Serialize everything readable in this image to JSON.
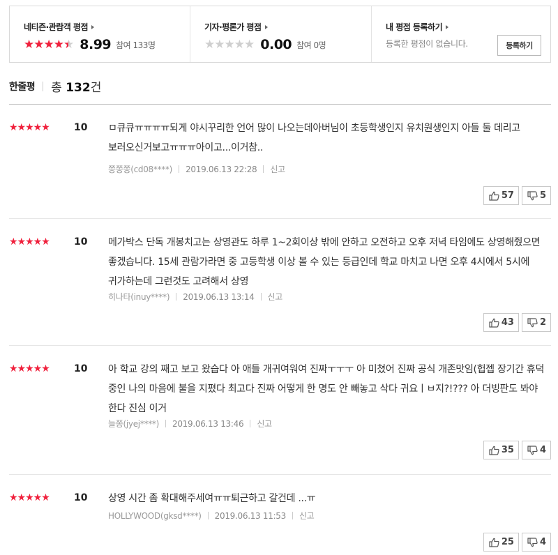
{
  "scores": {
    "audience": {
      "title": "네티즌·관람객 평점",
      "stars": [
        "on",
        "on",
        "on",
        "on",
        "half"
      ],
      "score": "8.99",
      "participants": "참여 133명"
    },
    "critic": {
      "title": "기자·평론가 평점",
      "stars": [
        "off",
        "off",
        "off",
        "off",
        "off"
      ],
      "score": "0.00",
      "participants": "참여 0명"
    },
    "mine": {
      "title": "내 평점 등록하기",
      "message": "등록한 평점이 없습니다.",
      "button_label": "등록하기"
    }
  },
  "list_header": {
    "label": "한줄평",
    "total_prefix": "총",
    "total_count": "132",
    "total_suffix": "건"
  },
  "reviews": [
    {
      "stars": "★★★★★",
      "score": "10",
      "text": "ㅁ큐큐ㅠㅠㅠㅠ되게 야시꾸리한 언어 많이 나오는데아버님이 초등학생인지 유치원생인지 아들 둘 데리고 보러오신거보고ㅠㅠㅠ아이고...이거참..",
      "author": "쫑쫑쫑(cd08****)",
      "date": "2019.06.13 22:28",
      "report": "신고",
      "likes": "57",
      "dislikes": "5"
    },
    {
      "stars": "★★★★★",
      "score": "10",
      "text": "메가박스 단독 개봉치고는 상영관도 하루 1~2회이상 밖에 안하고 오전하고 오후 저녁 타임에도 상영해줬으면 좋겠습니다. 15세 관람가라면 중 고등학생 이상 볼 수 있는 등급인데 학교 마치고 나면 오후 4시에서 5시에 귀가하는데 그런것도 고려해서 상영",
      "author": "히나타(inuy****)",
      "date": "2019.06.13 13:14",
      "report": "신고",
      "likes": "43",
      "dislikes": "2"
    },
    {
      "stars": "★★★★★",
      "score": "10",
      "text": "아 학교 강의 째고 보고 왔습다 아 애들 개귀여워여 진짜ㅜㅜㅜ 아 미쳤어 진짜 공식 개존맛임(헙젭 장기간 휴덕 중인 나의 마음에 불을 지폈다 최고다 진짜 어떻게 한 명도 안 빼놓고 삭다 귀요ㅣㅂ지?!??? 아 더빙판도 봐야 한다 진심 이거",
      "author": "늘쫑(jyej****)",
      "date": "2019.06.13 13:46",
      "report": "신고",
      "likes": "35",
      "dislikes": "4"
    },
    {
      "stars": "★★★★★",
      "score": "10",
      "text": "상영 시간 좀 확대해주세여ㅠㅠ퇴근하고 갈건데 ...ㅠ",
      "author": "HOLLYWOOD(gksd****)",
      "date": "2019.06.13 11:53",
      "report": "신고",
      "likes": "25",
      "dislikes": "4"
    }
  ],
  "colors": {
    "star": "#f0213d",
    "star_off": "#cfcfcf"
  },
  "icons": {
    "like": "thumbs-up-icon",
    "dislike": "thumbs-down-icon",
    "title_arrow": "triangle-right-icon"
  }
}
